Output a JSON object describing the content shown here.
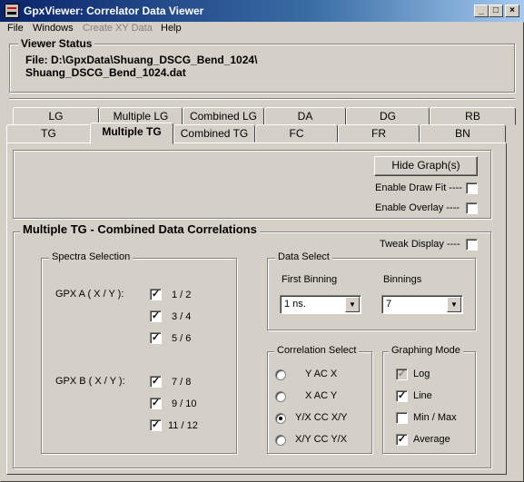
{
  "window": {
    "title": "GpxViewer: Correlator Data Viewer",
    "controls": {
      "minimize": "_",
      "maximize": "□",
      "close": "×"
    }
  },
  "menu": [
    "File",
    "Windows",
    "Create XY Data",
    "Help"
  ],
  "status": {
    "heading": "Viewer Status",
    "line1": "File: D:\\GpxData\\Shuang_DSCG_Bend_1024\\",
    "line2": "Shuang_DSCG_Bend_1024.dat"
  },
  "tabs_back": [
    "LG",
    "Multiple LG",
    "Combined LG",
    "DA",
    "DG",
    "RB"
  ],
  "tabs_front": [
    "TG",
    "Multiple TG",
    "Combined TG",
    "FC",
    "FR",
    "BN"
  ],
  "top_panel": {
    "hide_graph": "Hide Graph(s)",
    "enable_draw_fit": "Enable Draw Fit ----",
    "enable_overlay": "Enable Overlay ----"
  },
  "main": {
    "title": "Multiple TG - Combined Data Correlations",
    "tweak_display": "Tweak Display ----"
  },
  "spectra": {
    "title": "Spectra Selection",
    "gpx_a": "GPX A  ( X / Y ):",
    "gpx_b": "GPX B  ( X / Y ):",
    "a_items": [
      "1 / 2",
      "3 / 4",
      "5 / 6"
    ],
    "b_items": [
      "7 / 8",
      "9 / 10",
      "11 / 12"
    ]
  },
  "data_select": {
    "title": "Data Select",
    "first_binning_label": "First Binning",
    "binnings_label": "Binnings",
    "first_binning_value": "1 ns.",
    "binnings_value": "7"
  },
  "correlation": {
    "title": "Correlation Select",
    "options": [
      "Y AC X",
      "X AC Y",
      "Y/X CC X/Y",
      "X/Y CC Y/X"
    ],
    "selected": 2
  },
  "graphing": {
    "title": "Graphing  Mode",
    "options": [
      "Log",
      "Line",
      "Min / Max",
      "Average"
    ]
  },
  "icons": {
    "app": "app-icon",
    "check": "✓",
    "arrow": "▼"
  }
}
